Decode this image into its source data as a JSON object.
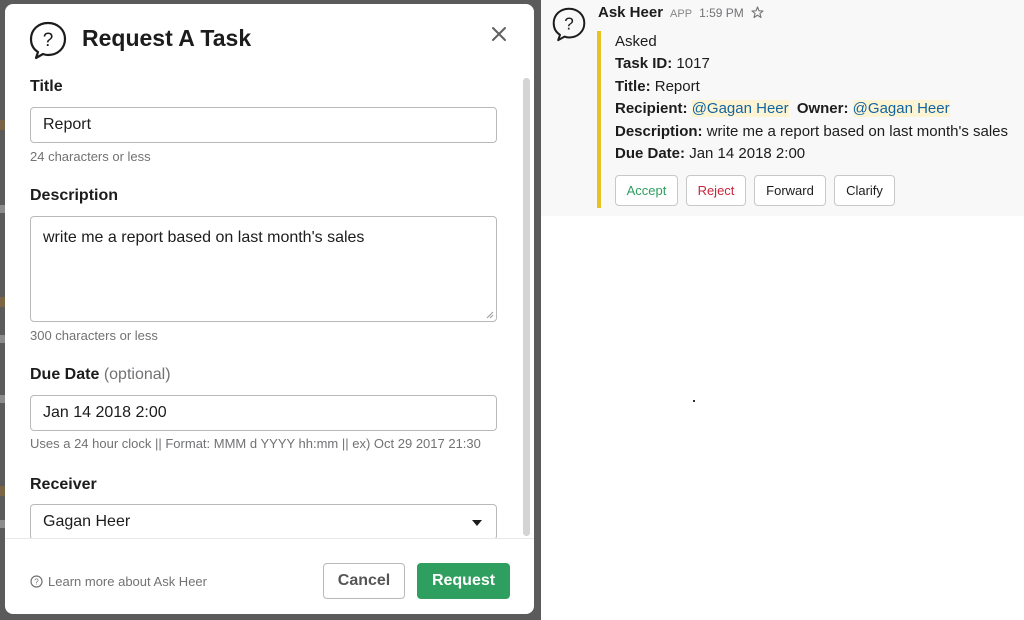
{
  "modal": {
    "title": "Request A Task",
    "fields": {
      "title": {
        "label": "Title",
        "value": "Report",
        "hint": "24 characters or less"
      },
      "description": {
        "label": "Description",
        "value": "write me a report based on last month's sales",
        "hint": "300 characters or less"
      },
      "due_date": {
        "label": "Due Date",
        "optional": "(optional)",
        "value": "Jan 14 2018 2:00",
        "hint": "Uses a 24 hour clock || Format: MMM d YYYY hh:mm || ex) Oct 29 2017 21:30"
      },
      "receiver": {
        "label": "Receiver",
        "value": "Gagan Heer"
      }
    },
    "footer": {
      "learn_more": "Learn more about Ask Heer",
      "cancel_label": "Cancel",
      "request_label": "Request"
    }
  },
  "message": {
    "sender": "Ask Heer",
    "badge": "APP",
    "time": "1:59 PM",
    "status": "Asked",
    "task_id_label": "Task ID:",
    "task_id": "1017",
    "title_label": "Title:",
    "title": "Report",
    "recipient_label": "Recipient:",
    "recipient": "@Gagan Heer",
    "owner_label": "Owner:",
    "owner": "@Gagan Heer",
    "description_label": "Description:",
    "description": "write me a report based on last month's sales",
    "due_date_label": "Due Date:",
    "due_date": "Jan 14 2018 2:00",
    "actions": {
      "accept": "Accept",
      "reject": "Reject",
      "forward": "Forward",
      "clarify": "Clarify"
    }
  },
  "colors": {
    "primary_button": "#2e9f5f",
    "attachment_bar": "#e8c221",
    "reject": "#c8283b",
    "mention": "#1264a3"
  },
  "icons": {
    "modal_header": "help-speech-bubble-icon",
    "close": "close-icon",
    "learn_more": "help-circle-icon",
    "star": "star-icon",
    "select": "chevron-down-icon"
  }
}
